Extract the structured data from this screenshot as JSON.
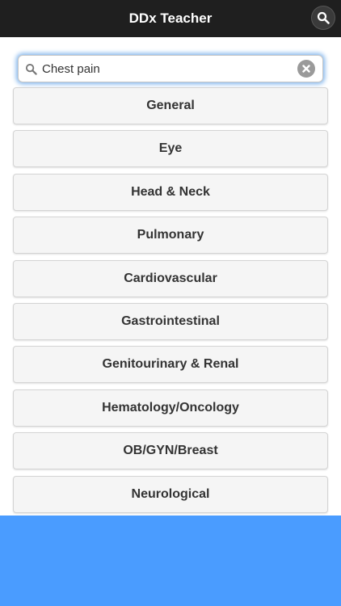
{
  "header": {
    "title": "DDx Teacher",
    "search_icon": "magnifier-icon"
  },
  "search": {
    "value": "Chest pain",
    "placeholder": "",
    "icon": "search-icon",
    "clear_icon": "clear-x-icon"
  },
  "categories": [
    {
      "label": "General"
    },
    {
      "label": "Eye"
    },
    {
      "label": "Head & Neck"
    },
    {
      "label": "Pulmonary"
    },
    {
      "label": "Cardiovascular"
    },
    {
      "label": "Gastrointestinal"
    },
    {
      "label": "Genitourinary & Renal"
    },
    {
      "label": "Hematology/Oncology"
    },
    {
      "label": "OB/GYN/Breast"
    },
    {
      "label": "Neurological"
    }
  ],
  "colors": {
    "header_bg": "#1f1f1f",
    "footer_bg": "#4a9cff",
    "button_bg": "#f5f5f5",
    "focus_glow": "#7fb4ec"
  }
}
